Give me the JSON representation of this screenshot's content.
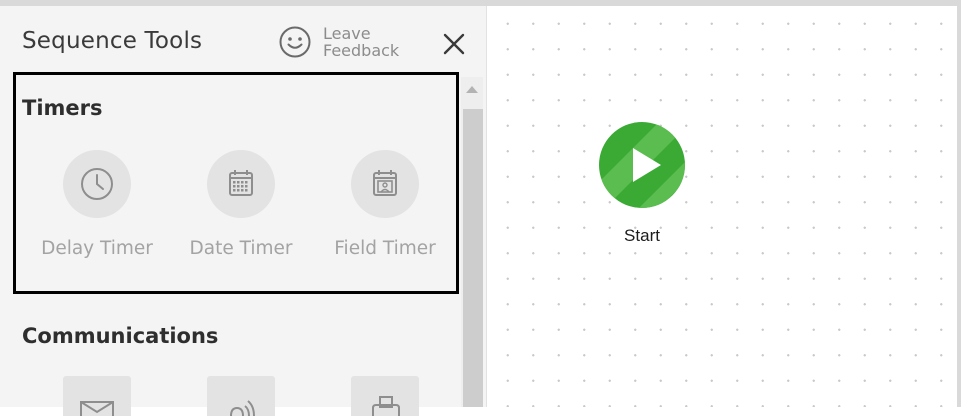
{
  "panel": {
    "title": "Sequence Tools",
    "feedback_line1": "Leave",
    "feedback_line2": "Feedback",
    "close_icon": "close-icon"
  },
  "timers": {
    "heading": "Timers",
    "tools": [
      {
        "label": "Delay Timer",
        "icon": "clock-icon"
      },
      {
        "label": "Date Timer",
        "icon": "calendar-icon"
      },
      {
        "label": "Field Timer",
        "icon": "field-calendar-icon"
      }
    ]
  },
  "communications": {
    "heading": "Communications",
    "tools": [
      {
        "icon": "email-icon"
      },
      {
        "icon": "voice-icon"
      },
      {
        "icon": "fax-icon"
      }
    ]
  },
  "canvas": {
    "start_label": "Start",
    "start_color": "#3aaa35"
  },
  "colors": {
    "panel_bg": "#f4f4f4",
    "icon_circle": "#e3e3e3",
    "label_gray": "#a3a3a3",
    "highlight_border": "#000000"
  }
}
